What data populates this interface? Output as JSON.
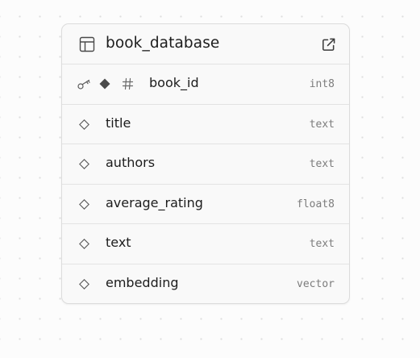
{
  "table": {
    "name": "book_database",
    "icon": "table-icon",
    "open_icon": "external-link-icon"
  },
  "columns": [
    {
      "name": "book_id",
      "type": "int8",
      "primary_key": true,
      "identity": true,
      "not_null": true
    },
    {
      "name": "title",
      "type": "text"
    },
    {
      "name": "authors",
      "type": "text"
    },
    {
      "name": "average_rating",
      "type": "float8"
    },
    {
      "name": "text",
      "type": "text"
    },
    {
      "name": "embedding",
      "type": "vector"
    }
  ]
}
